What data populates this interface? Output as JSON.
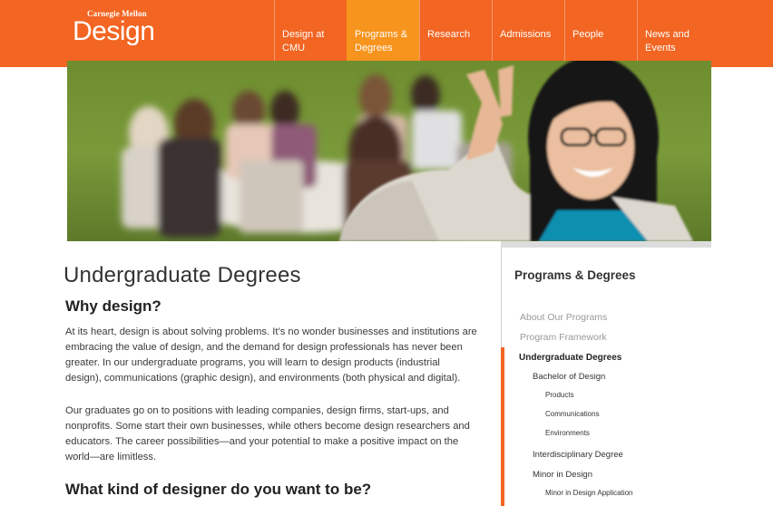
{
  "header": {
    "logo_small": "Carnegie Mellon",
    "logo_big": "Design",
    "nav": [
      {
        "label": "Design at CMU"
      },
      {
        "label": "Programs & Degrees"
      },
      {
        "label": "Research"
      },
      {
        "label": "Admissions"
      },
      {
        "label": "People"
      },
      {
        "label": "News and Events"
      }
    ]
  },
  "main": {
    "title": "Undergraduate Degrees",
    "heading1": "Why design?",
    "para1": "At its heart, design is about solving problems. It’s no wonder businesses and institutions are embracing the value of design, and the demand for design professionals has never been greater. In our undergraduate programs, you will learn to design products (industrial design), communications (graphic design), and environments (both physical and digital).",
    "para2": "Our graduates go on to positions with leading companies, design firms, start-ups, and nonprofits. Some start their own businesses, while others become design researchers and educators. The career possibilities—and your potential to make a positive impact on the world—are limitless.",
    "heading2": "What kind of designer do you want to be?"
  },
  "sidebar": {
    "title": "Programs & Degrees",
    "items": [
      {
        "label": "About Our Programs"
      },
      {
        "label": "Program Framework"
      },
      {
        "label": "Undergraduate Degrees"
      },
      {
        "label": "Bachelor of Design"
      },
      {
        "label": "Products"
      },
      {
        "label": "Communications"
      },
      {
        "label": "Environments"
      },
      {
        "label": "Interdisciplinary Degree"
      },
      {
        "label": "Minor in Design"
      },
      {
        "label": "Minor in Design Application"
      }
    ]
  },
  "colors": {
    "brand_orange": "#f26522",
    "active_nav": "#f7941d"
  }
}
